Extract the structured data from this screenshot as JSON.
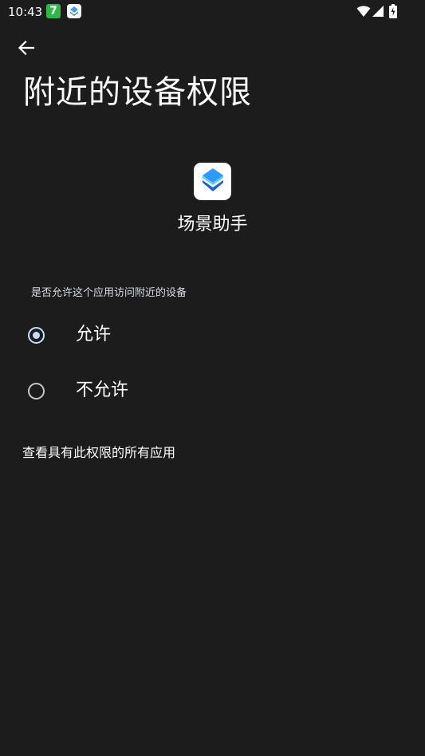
{
  "status_bar": {
    "time": "10:43",
    "notification_badge": "7",
    "icons": [
      "wifi-icon",
      "signal-icon",
      "battery-charging-icon"
    ]
  },
  "header": {
    "back_icon": "arrow-left-icon",
    "title": "附近的设备权限"
  },
  "app": {
    "icon": "layers-icon",
    "name": "场景助手"
  },
  "permission": {
    "question": "是否允许这个应用访问附近的设备",
    "options": [
      {
        "label": "允许",
        "selected": true
      },
      {
        "label": "不允许",
        "selected": false
      }
    ]
  },
  "link": {
    "label": "查看具有此权限的所有应用"
  },
  "colors": {
    "background": "#1c1c1c",
    "accent": "#c6dcff",
    "text": "#ffffff"
  }
}
